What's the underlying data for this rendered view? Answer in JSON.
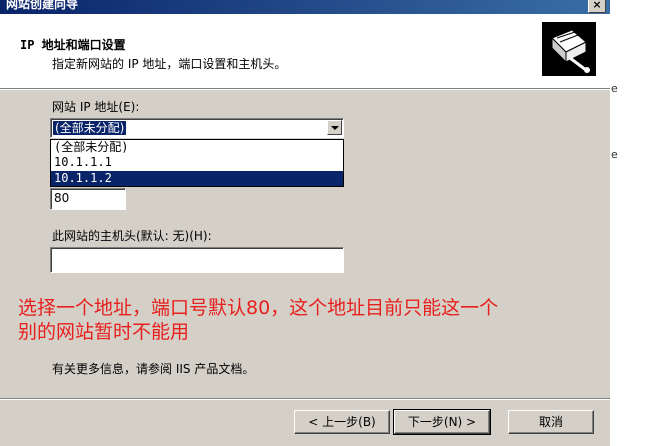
{
  "window": {
    "title": "网站创建向导",
    "close_glyph": "×"
  },
  "header": {
    "title": "IP 地址和端口设置",
    "subtitle": "指定新网站的 IP 地址，端口设置和主机头。"
  },
  "form": {
    "ip_label": "网站 IP 地址(E):",
    "ip_selected": "(全部未分配)",
    "ip_options": [
      "(全部未分配)",
      "10.1.1.1",
      "10.1.1.2"
    ],
    "ip_highlighted_index": 2,
    "port_value": "80",
    "host_label": "此网站的主机头(默认: 无)(H):",
    "host_value": ""
  },
  "annotation": {
    "line1": "选择一个地址，端口号默认80，这个地址目前只能这一个",
    "line2": "别的网站暂时不能用",
    "color": "#e8201d"
  },
  "info_text": "有关更多信息，请参阅 IIS 产品文档。",
  "buttons": {
    "back": "< 上一步(B)",
    "next": "下一步(N) >",
    "cancel": "取消"
  },
  "background_glyphs": [
    "e",
    "e"
  ]
}
